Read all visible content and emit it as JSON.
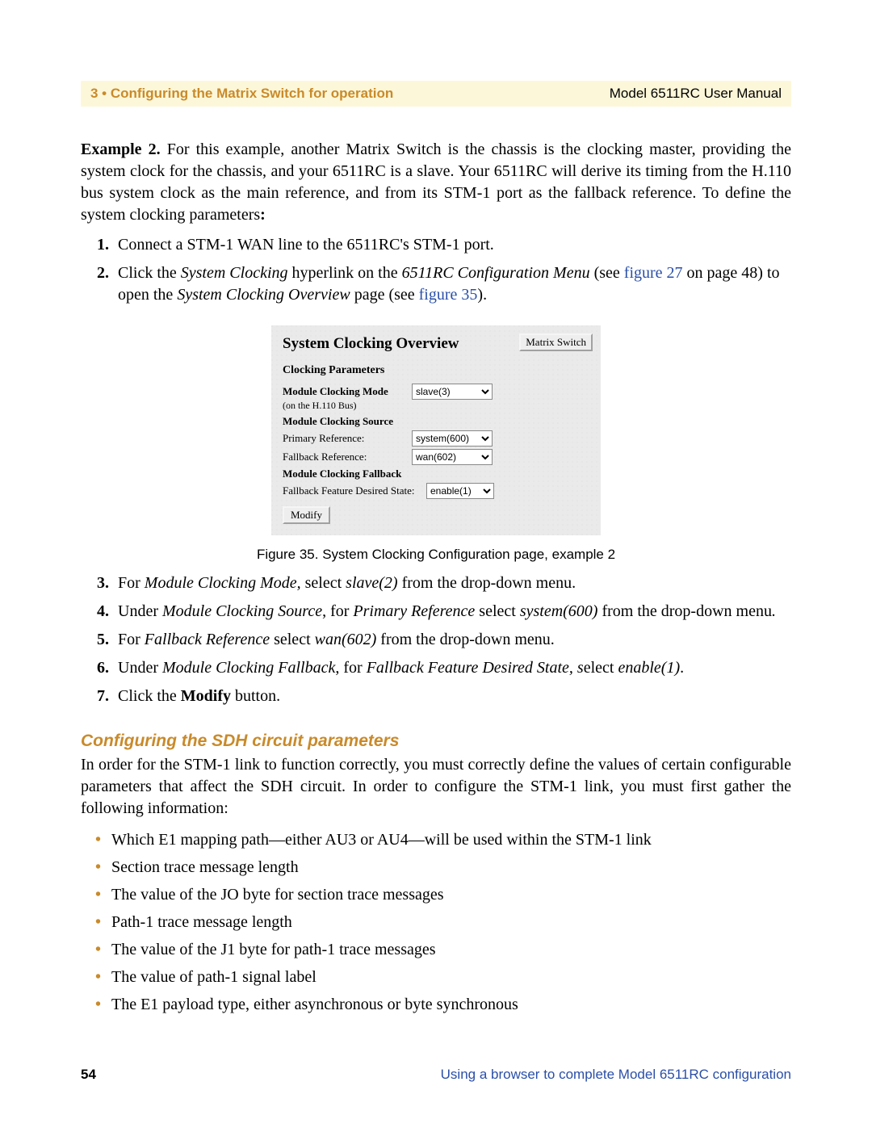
{
  "header": {
    "left": "3 • Configuring the Matrix Switch for operation",
    "right": "Model 6511RC User Manual"
  },
  "example": {
    "label": "Example 2.",
    "text": " For this example, another Matrix Switch is the chassis is the clocking master, providing the system clock for the chassis, and your 6511RC is a slave. Your 6511RC will derive its timing from the H.110 bus system clock as the main reference, and from its STM-1 port as the fallback reference. To define the system clocking parameters",
    "colon": ":"
  },
  "steps_top": {
    "s1": "Connect a STM-1 WAN line to the 6511RC's STM-1 port.",
    "s2_a": "Click the ",
    "s2_i1": "System Clocking",
    "s2_b": " hyperlink on the ",
    "s2_i2": "6511RC Configuration Menu",
    "s2_c": " (see ",
    "s2_link1": "figure 27",
    "s2_d": " on page 48) to open the ",
    "s2_i3": "System Clocking Overview",
    "s2_e": " page (see ",
    "s2_link2": "figure 35",
    "s2_f": ")."
  },
  "figure": {
    "title": "System Clocking Overview",
    "nav_btn": "Matrix Switch",
    "section1": "Clocking Parameters",
    "row_mode_label": "Module Clocking Mode",
    "row_mode_sub": "(on the H.110 Bus)",
    "row_mode_value": "slave(3)",
    "section2": "Module Clocking Source",
    "row_primary_label": "Primary Reference:",
    "row_primary_value": "system(600)",
    "row_fallback_label": "Fallback Reference:",
    "row_fallback_value": "wan(602)",
    "section3": "Module Clocking Fallback",
    "row_state_label": "Fallback Feature Desired State:",
    "row_state_value": "enable(1)",
    "modify": "Modify",
    "caption": "Figure 35. System Clocking Configuration page, example 2"
  },
  "steps_bottom": {
    "s3_a": "For ",
    "s3_i1": "Module Clocking Mode,",
    "s3_b": " select ",
    "s3_i2": "slave(2)",
    "s3_c": " from the drop-down menu.",
    "s4_a": "Under ",
    "s4_i1": "Module Clocking Source",
    "s4_b": ", for ",
    "s4_i2": "Primary Reference",
    "s4_c": " select ",
    "s4_i3": "system(600)",
    "s4_d": " from the drop-down menu",
    "s4_i4": ".",
    "s5_a": "For ",
    "s5_i1": "Fallback Reference",
    "s5_b": " select ",
    "s5_i2": "wan(602)",
    "s5_c": " from the drop-down menu.",
    "s6_a": "Under ",
    "s6_i1": "Module Clocking Fallback",
    "s6_b": ", for ",
    "s6_i2": "Fallback Feature Desired State, s",
    "s6_c": "elect ",
    "s6_i3": "enable(1)",
    "s6_d": ".",
    "s7_a": "Click the ",
    "s7_b": "Modify",
    "s7_c": " button."
  },
  "sdh": {
    "heading": "Configuring the SDH circuit parameters",
    "intro": "In order for the STM-1 link to function correctly, you must correctly define the values of certain configurable parameters that affect the SDH circuit. In order to configure the STM-1 link, you must first gather the following information:",
    "bullets": [
      "Which E1 mapping path—either AU3 or AU4—will be used within the STM-1 link",
      "Section trace message length",
      "The value of the JO byte for section trace messages",
      "Path-1 trace message length",
      "The value of the J1 byte for path-1 trace messages",
      "The value of path-1 signal label",
      "The E1 payload type, either asynchronous or byte synchronous"
    ]
  },
  "footer": {
    "page": "54",
    "text": "Using a browser to complete Model 6511RC configuration"
  }
}
